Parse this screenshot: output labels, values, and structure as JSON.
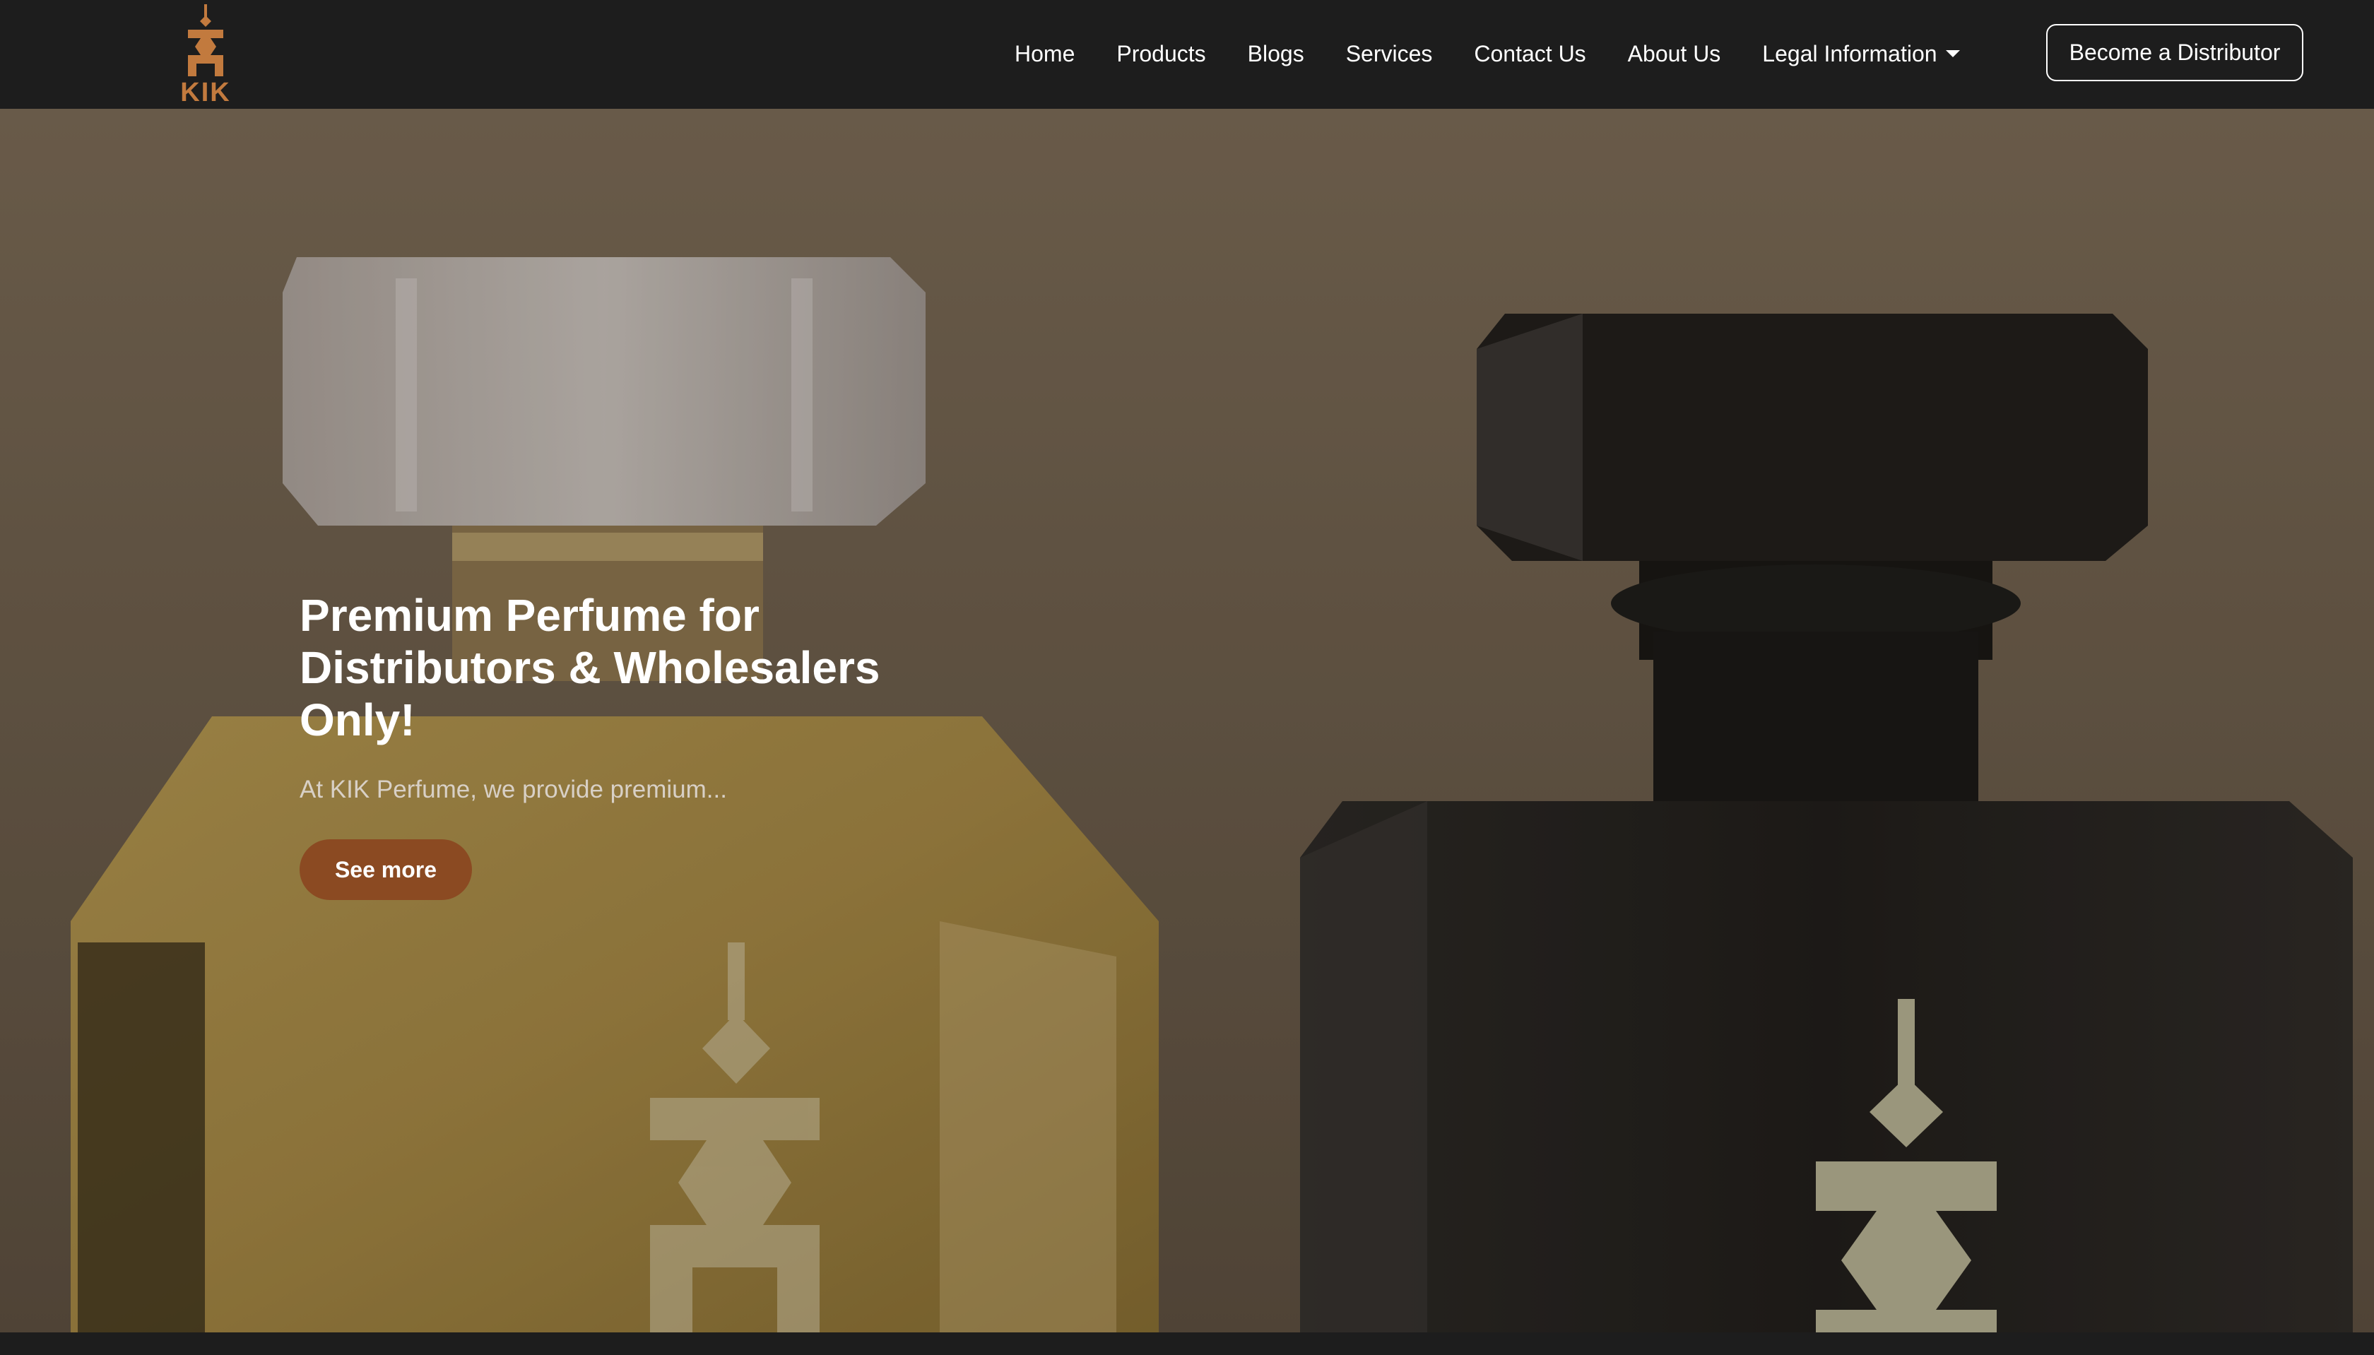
{
  "brand": {
    "logo_text": "KIK",
    "logo_color": "#c27a3e"
  },
  "nav": {
    "items": [
      {
        "label": "Home"
      },
      {
        "label": "Products"
      },
      {
        "label": "Blogs"
      },
      {
        "label": "Services"
      },
      {
        "label": "Contact Us"
      },
      {
        "label": "About Us"
      },
      {
        "label": "Legal Information",
        "dropdown": true,
        "icon": "caret-down-icon"
      }
    ],
    "cta_label": "Become a Distributor"
  },
  "hero": {
    "title": "Premium Perfume for Distributors & Wholesalers Only!",
    "subtitle": "At KIK Perfume, we provide premium...",
    "button_label": "See more",
    "button_color": "#8b4a22"
  },
  "colors": {
    "navbar_bg": "#1d1d1d",
    "hero_bg": "#7a6a57",
    "text_primary": "#ffffff"
  }
}
